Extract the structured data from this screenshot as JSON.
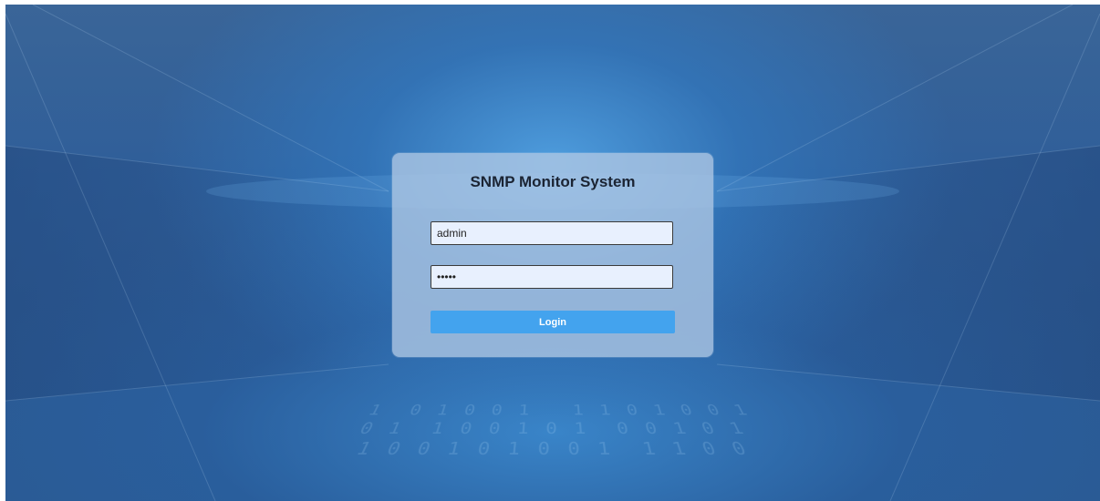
{
  "app": {
    "title": "SNMP Monitor System"
  },
  "login_form": {
    "username_value": "admin",
    "password_value": "•••••",
    "login_label": "Login"
  },
  "background": {
    "binary_text": "1  0 1 0 0 1   1 1 0 1 0 0 1\n0 1  1 0 0 1 0 1  0 0 1 0 1\n1 0 0 1 0 1 0 0 1  1 1 0 0",
    "colors": {
      "accent": "#43a3ee",
      "field_bg": "#e8f0fe",
      "card_bg": "#afc8e4"
    }
  }
}
